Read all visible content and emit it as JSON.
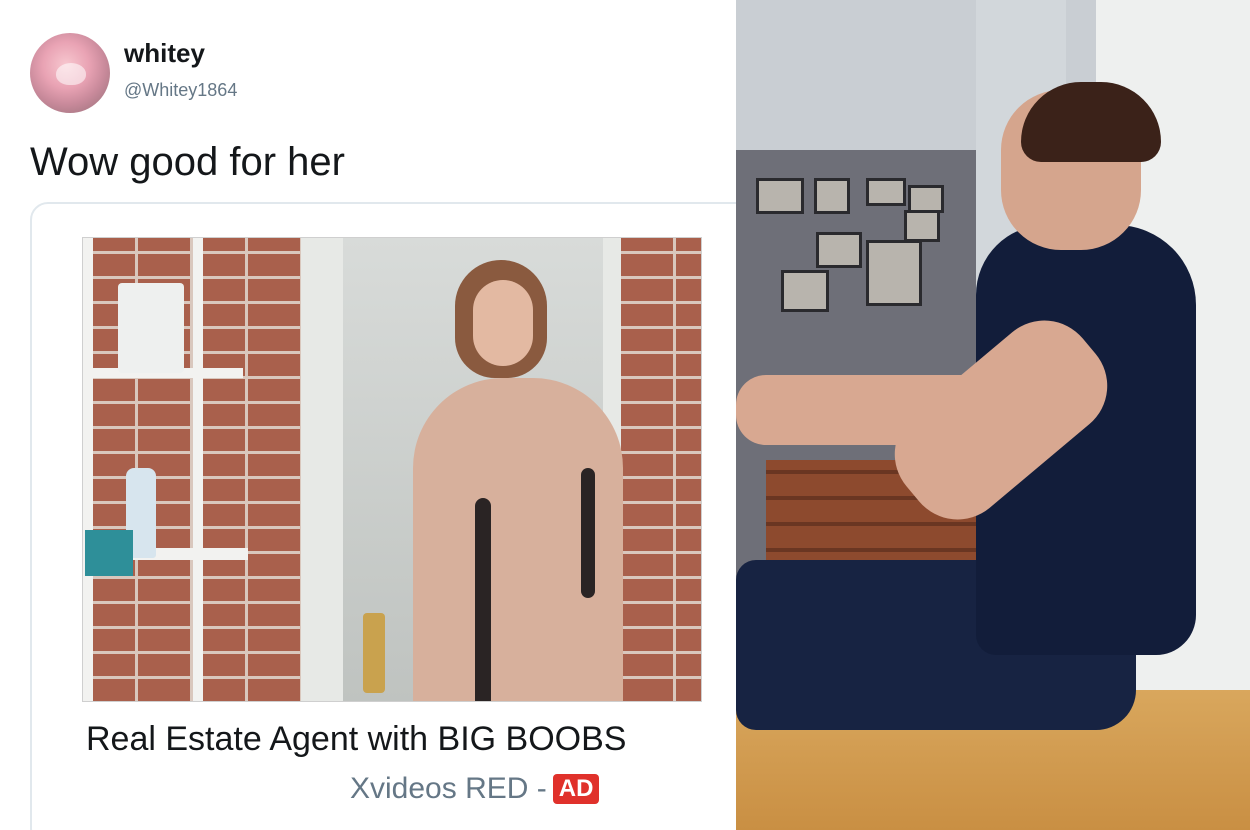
{
  "tweet": {
    "display_name": "whitey",
    "handle": "@Whitey1864",
    "text": "Wow good for her"
  },
  "card": {
    "title": "Real Estate Agent with BIG BOOBS",
    "source": "Xvideos RED -",
    "badge": "AD"
  },
  "colors": {
    "handle_text": "#657786",
    "card_border": "#e1e8ed",
    "ad_badge": "#e0312b"
  }
}
